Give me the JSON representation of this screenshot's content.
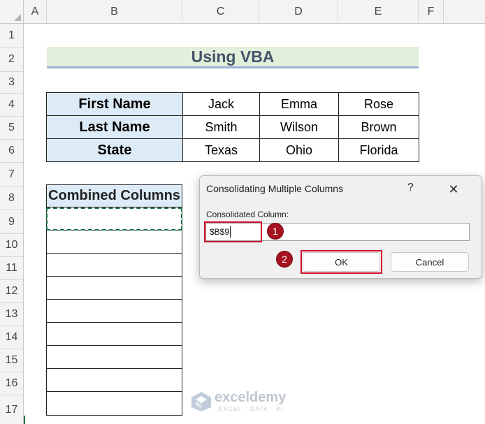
{
  "columns": [
    "A",
    "B",
    "C",
    "D",
    "E",
    "F"
  ],
  "rows": [
    "1",
    "2",
    "3",
    "4",
    "5",
    "6",
    "7",
    "8",
    "9",
    "10",
    "11",
    "12",
    "13",
    "14",
    "15",
    "16",
    "17"
  ],
  "sheet_title": "Using VBA",
  "table": {
    "rows": [
      {
        "header": "First Name",
        "values": [
          "Jack",
          "Emma",
          "Rose"
        ]
      },
      {
        "header": "Last Name",
        "values": [
          "Smith",
          "Wilson",
          "Brown"
        ]
      },
      {
        "header": "State",
        "values": [
          "Texas",
          "Ohio",
          "Florida"
        ]
      }
    ]
  },
  "combined": {
    "header": "Combined Columns"
  },
  "dialog": {
    "title": "Consolidating Multiple Columns",
    "help": "?",
    "close": "✕",
    "field_label": "Consolidated Column:",
    "field_value": "$B$9",
    "ok": "OK",
    "cancel": "Cancel"
  },
  "badges": [
    "1",
    "2"
  ],
  "watermark": {
    "name": "exceldemy",
    "tagline": "EXCEL · DATA · BI"
  },
  "colors": {
    "title_fill": "#e2efda",
    "title_text": "#44546a",
    "header_fill": "#ddebf7",
    "highlight": "#d0102b",
    "badge": "#a6121f"
  }
}
